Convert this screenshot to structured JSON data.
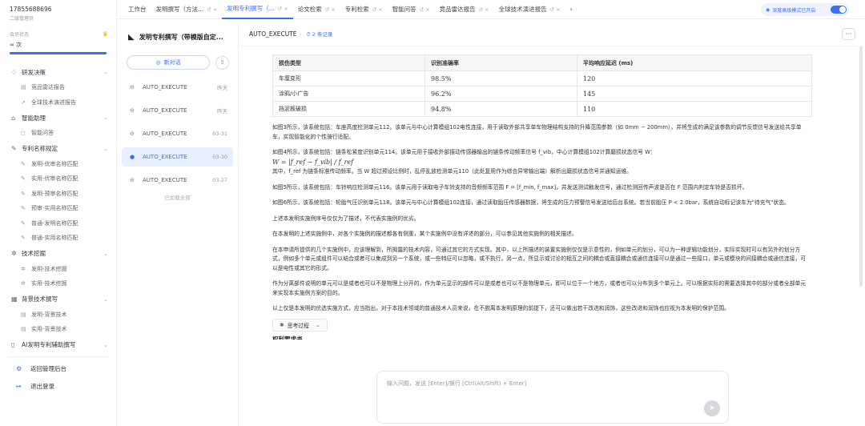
{
  "user": {
    "phone": "17855688696",
    "sub": "二级管理员"
  },
  "member": {
    "label": "会员状态",
    "quota": "∞ 次",
    "progress": 0.98
  },
  "nav": [
    {
      "icon": "lightbulb-icon",
      "glyph": "♢",
      "label": "研发决策",
      "items": [
        {
          "icon": "document-icon",
          "glyph": "▤",
          "label": "竞品雷达报告"
        },
        {
          "icon": "trend-icon",
          "glyph": "↗",
          "label": "全球技术演进报告"
        }
      ]
    },
    {
      "icon": "robot-icon",
      "glyph": "⌂",
      "label": "智能助理",
      "items": [
        {
          "icon": "chat-icon",
          "glyph": "◻",
          "label": "智能问答"
        }
      ]
    },
    {
      "icon": "pen-icon",
      "glyph": "✎",
      "label": "专利名称规定",
      "items": [
        {
          "icon": "pen-icon",
          "glyph": "✎",
          "label": "发明-优审名称匹配"
        },
        {
          "icon": "pen-icon",
          "glyph": "✎",
          "label": "实用-优审名称匹配"
        },
        {
          "icon": "pen-icon",
          "glyph": "✎",
          "label": "发明-预审名称匹配"
        },
        {
          "icon": "pen-icon",
          "glyph": "✎",
          "label": "预审-实用名称匹配"
        },
        {
          "icon": "pen-icon",
          "glyph": "✎",
          "label": "普通-发明名称匹配"
        },
        {
          "icon": "pen-icon",
          "glyph": "✎",
          "label": "普通-实用名称匹配"
        }
      ]
    },
    {
      "icon": "star-icon",
      "glyph": "✲",
      "label": "技术挖掘",
      "items": [
        {
          "icon": "star-icon",
          "glyph": "✲",
          "label": "发明-技术挖掘"
        },
        {
          "icon": "star-icon",
          "glyph": "✲",
          "label": "实用-技术挖掘"
        }
      ]
    },
    {
      "icon": "grid-icon",
      "glyph": "▦",
      "label": "背景技术撰写",
      "items": [
        {
          "icon": "document-icon",
          "glyph": "▤",
          "label": "发明-背景技术"
        },
        {
          "icon": "document-icon",
          "glyph": "▤",
          "label": "实用-背景技术"
        }
      ]
    },
    {
      "icon": "book-icon",
      "glyph": "▯",
      "label": "AI发明专利辅助撰写",
      "items": []
    }
  ],
  "bottom": [
    {
      "icon": "gear-icon",
      "glyph": "⚙",
      "label": "返回管理后台"
    },
    {
      "icon": "logout-icon",
      "glyph": "↦",
      "label": "退出登录"
    }
  ],
  "tabs": [
    {
      "label": "工作台",
      "closable": false,
      "active": false
    },
    {
      "label": "发明撰写（方法...",
      "closable": true,
      "active": false
    },
    {
      "label": "发明专利撰写（...",
      "closable": true,
      "active": true
    },
    {
      "label": "论文检索",
      "closable": true,
      "active": false
    },
    {
      "label": "专利检索",
      "closable": true,
      "active": false
    },
    {
      "label": "智能问答",
      "closable": true,
      "active": false
    },
    {
      "label": "竞品雷达报告",
      "closable": true,
      "active": false
    },
    {
      "label": "全球技术演进报告",
      "closable": true,
      "active": false
    },
    {
      "label": "›",
      "closable": false,
      "active": false
    }
  ],
  "tab_close_glyph": "↺ ×",
  "deep_mode": {
    "label": "深度高级模式已开启",
    "on": true
  },
  "sessions": {
    "title": "发明专利撰写（带模版自定...",
    "new_chat": "新对话",
    "items": [
      {
        "label": "AUTO_EXECUTE",
        "date": "昨天",
        "active": false
      },
      {
        "label": "AUTO_EXECUTE",
        "date": "昨天",
        "active": false
      },
      {
        "label": "AUTO_EXECUTE",
        "date": "03-31",
        "active": false
      },
      {
        "label": "AUTO_EXECUTE",
        "date": "03-30",
        "active": true
      },
      {
        "label": "AUTO_EXECUTE",
        "date": "03-27",
        "active": false
      }
    ],
    "loaded_all": "已加载全部"
  },
  "main": {
    "title": "AUTO_EXECUTE",
    "records": "2 条记录",
    "table": {
      "headers": [
        "损伤类型",
        "识别准确率",
        "平均响应延迟 (ms)"
      ],
      "rows": [
        [
          "车厘变形",
          "98.5%",
          "120"
        ],
        [
          "涂鸦/小广告",
          "96.2%",
          "145"
        ],
        [
          "挡泥板破损",
          "94.8%",
          "110"
        ]
      ]
    },
    "p1": "如图3所示，该系统包括：车座高度检测单元112。该单元与中心计算模组102电性连接，用于读取外部共享单车物理结构支持的升降范围参数（如 0mm − 200mm），并将生成的满足该参数的调节反馈信号发送给共享单车，实现智能化的个性骑行适配。",
    "p2a": "如图4所示，该系统包括：链条松紧度识别单元114。该单元用于接收外部振动传感器输出的链条传动频率信号 f_vib，中心计算模组102计算磨损状态信号 W：",
    "p2f": "W = |f_ref − f_vib| / f_ref",
    "p2b": "其中，f_ref 为链条标准传动频率。当 W 超过预设比例时，乱停乱放检测单元110（此处复用作为综合异常输出端）解析出磨损状态信号并通知运维。",
    "p3": "如图5所示，该系统包括：车铃响应检测单元116。该单元用于读取电子车铃支持的音频频率范围 F = [f_min, f_max]，并发送测试触发信号，通过检测回传声波是否在 F 范围内判定车铃是否损坏。",
    "p4": "如图6所示，该系统包括：轮胎气压识别单元118。该单元与中心计算模组102连接，通过读取胎压传感器数据，将生成的压力预警信号发送给后台系统。若当前胎压 P < 2.0bar，系统自动标记该车为\"待充气\"状态。",
    "p5": "上述本发明实施例序号仅仅为了描述，不代表实施例的优劣。",
    "p6": "在本发明的上述实施例中，对各个实施例的描述都各有侧重，某个实施例中没有详述的部分，可以参见其他实施例的相关描述。",
    "p7": "在本申请所提供的几个实施例中，应该理解到，所揭露的技术内容，可通过其它的方式实现。其中，以上所描述的装置实施例仅仅是示意性的，例如单元的划分，可以为一种逻辑功能划分，实际实现时可以有另外的划分方式，例如多个单元或组件可以结合或者可以集成到另一个系统，或一些特征可以忽略，或不执行。另一点，所显示或讨论的相互之间的耦合或直接耦合或通信连接可以是通过一些接口，单元或模块的间接耦合或通信连接，可以是电性或其它的形式。",
    "p8": "作为分离部件说明的单元可以是或者也可以不是物理上分开的，作为单元显示的部件可以是或者也可以不是物理单元，即可以位于一个地方，或者也可以分布到多个单元上。可以根据实际的需要选择其中的部分或者全部单元来实现本实施例方案的目的。",
    "p9": "以上仅是本发明的优选实施方式，应当指出，对于本技术领域的普通技术人员来说，在不脱离本发明原理的前提下，还可以做出若干改进和润饰，这些改进和润饰也应视为本发明的保护范围。",
    "think": "思考过程",
    "cut_heading": "权利要求书"
  },
  "input": {
    "placeholder": "输入问题，发送 [Enter]/换行 [Ctrl(Alt/Shift) + Enter]"
  },
  "colors": {
    "accent": "#3b6ff2",
    "active_bg": "#e8efff"
  }
}
